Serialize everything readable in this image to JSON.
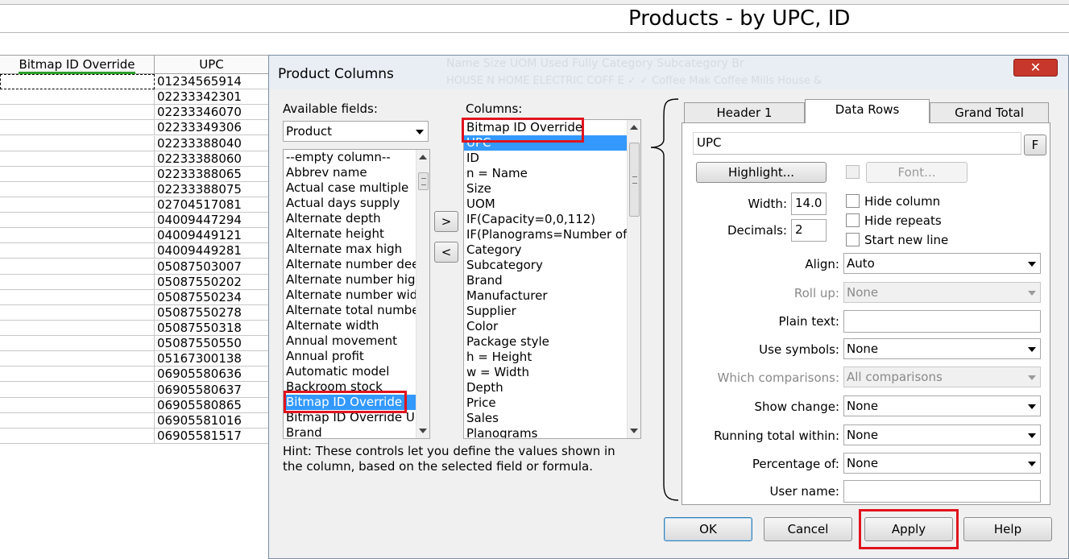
{
  "report": {
    "title": "Products - by UPC, ID",
    "columns": {
      "bitmap": "Bitmap ID Override",
      "upc": "UPC"
    },
    "upc_values": [
      "01234565914",
      "02233342301",
      "02233346070",
      "02233349306",
      "02233388040",
      "02233388060",
      "02233388065",
      "02233388075",
      "02704517081",
      "04009447294",
      "04009449121",
      "04009449281",
      "05087503007",
      "05087550202",
      "05087550234",
      "05087550278",
      "05087550318",
      "05087550550",
      "05167300138",
      "06905580636",
      "06905580637",
      "06905580865",
      "06905581016",
      "06905581517"
    ]
  },
  "dialog": {
    "title": "Product Columns",
    "ghost_header": "Name          Size     UOM     Used     Fully     Category      Subcategory      Br",
    "ghost_row": "HOUSE N HOME ELECTRIC COFF        E           ✓         ✓     Coffee Mak     Coffee Mills     House &",
    "close": "✕",
    "available": {
      "label": "Available fields:",
      "source": "Product",
      "items": [
        "--empty column--",
        "Abbrev name",
        "Actual case multiple",
        "Actual days supply",
        "Alternate depth",
        "Alternate height",
        "Alternate max high",
        "Alternate number dee",
        "Alternate number hig",
        "Alternate number wid",
        "Alternate total numbe",
        "Alternate width",
        "Annual movement",
        "Annual profit",
        "Automatic model",
        "Backroom stock",
        "Bitmap ID Override",
        "Bitmap ID Override U",
        "Brand"
      ],
      "selected_index": 16
    },
    "move": {
      "add": ">",
      "remove": "<"
    },
    "columns": {
      "label": "Columns:",
      "items": [
        "Bitmap ID Override",
        "UPC",
        "ID",
        "n = Name",
        "Size",
        "UOM",
        "IF(Capacity=0,0,112)",
        "IF(Planograms=Number of",
        "Category",
        "Subcategory",
        "Brand",
        "Manufacturer",
        "Supplier",
        "Color",
        "Package style",
        "h = Height",
        "w = Width",
        "Depth",
        "Price",
        "Sales",
        "Planograms"
      ],
      "selected_index": 1
    },
    "hint": "Hint:  These controls let you define the values shown in the column, based on the selected field or formula.",
    "tabs": [
      "Header 1",
      "Data Rows",
      "Grand Total"
    ],
    "active_tab": "Data Rows",
    "data_rows": {
      "formula": "UPC",
      "formula_button": "F",
      "highlight": "Highlight...",
      "font": "Font...",
      "width_label": "Width:",
      "width": "14.0",
      "decimals_label": "Decimals:",
      "decimals": "2",
      "hide_column": "Hide column",
      "hide_repeats": "Hide repeats",
      "start_new_line": "Start new line",
      "align_label": "Align:",
      "align": "Auto",
      "rollup_label": "Roll up:",
      "rollup": "None",
      "plain_text_label": "Plain text:",
      "plain_text": "",
      "use_symbols_label": "Use symbols:",
      "use_symbols": "None",
      "which_comparisons_label": "Which comparisons:",
      "which_comparisons": "All comparisons",
      "show_change_label": "Show change:",
      "show_change": "None",
      "running_total_label": "Running total within:",
      "running_total": "None",
      "percentage_label": "Percentage of:",
      "percentage": "None",
      "user_name_label": "User name:",
      "user_name": ""
    },
    "buttons": {
      "ok": "OK",
      "cancel": "Cancel",
      "apply": "Apply",
      "help": "Help"
    },
    "highlight_color": "#e0141e"
  }
}
